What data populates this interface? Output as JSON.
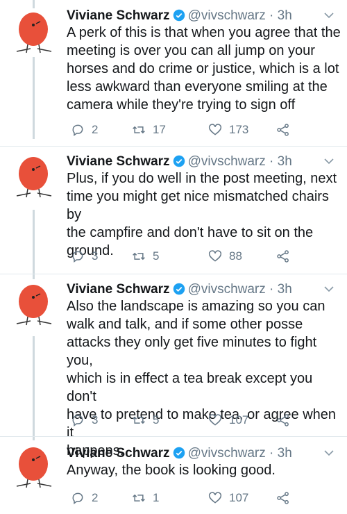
{
  "tweets": [
    {
      "name": "Viviane Schwarz",
      "handle": "@vivschwarz",
      "sep": "·",
      "time": "3h",
      "lines": [
        "A perk of this is that when you agree that the",
        "meeting is over you can all jump on your",
        "horses and do crime or justice, which is a lot",
        "less awkward than everyone smiling at the",
        "camera while they're trying to sign off"
      ],
      "replies": "2",
      "retweets": "17",
      "likes": "173"
    },
    {
      "name": "Viviane Schwarz",
      "handle": "@vivschwarz",
      "sep": "·",
      "time": "3h",
      "lines": [
        "Plus, if you do well in the post meeting, next",
        "time you might get nice mismatched chairs by",
        "the campfire and don't have to sit on the",
        "ground."
      ],
      "replies": "3",
      "retweets": "5",
      "likes": "88"
    },
    {
      "name": "Viviane Schwarz",
      "handle": "@vivschwarz",
      "sep": "·",
      "time": "3h",
      "lines": [
        "Also the landscape is amazing so you can",
        "walk and talk, and if some other posse",
        "attacks they only get five minutes to fight you,",
        "which is in effect a tea break except you don't",
        "have to pretend to make tea, or agree when it",
        "happens."
      ],
      "replies": "3",
      "retweets": "5",
      "likes": "107"
    },
    {
      "name": "Viviane Schwarz",
      "handle": "@vivschwarz",
      "sep": "·",
      "time": "3h",
      "lines": [
        "Anyway, the book is looking good."
      ],
      "replies": "2",
      "retweets": "1",
      "likes": "107"
    }
  ],
  "colors": {
    "verified": "#1da1f2",
    "avatar_bird": "#e8503a",
    "meta_gray": "#657786",
    "thread_line": "#cfd9de"
  },
  "icons": [
    "verified-badge-icon",
    "chevron-down-icon",
    "reply-icon",
    "retweet-icon",
    "like-icon",
    "share-icon"
  ]
}
